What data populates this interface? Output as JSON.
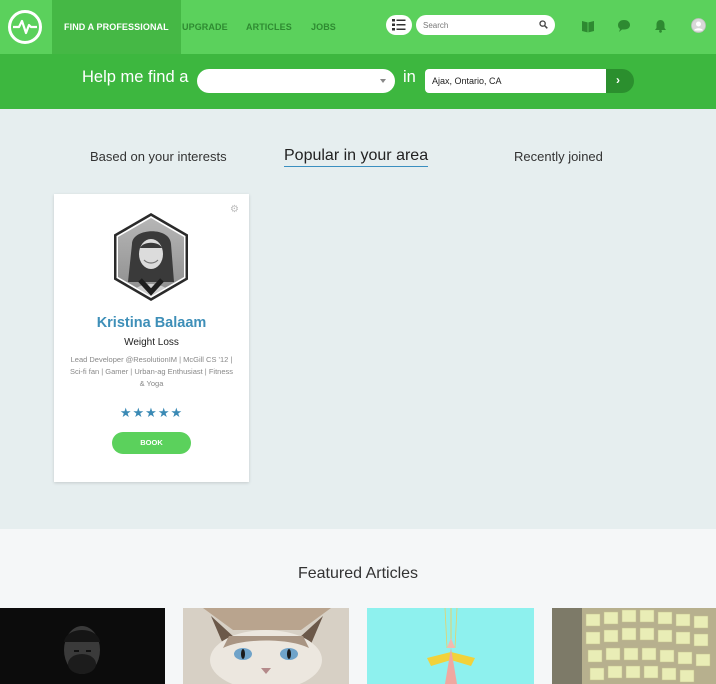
{
  "nav": {
    "items": [
      {
        "label": "FIND A PROFESSIONAL",
        "active": true
      },
      {
        "label": "UPGRADE"
      },
      {
        "label": "ARTICLES"
      },
      {
        "label": "JOBS"
      }
    ],
    "search_placeholder": "Search",
    "icons": [
      "list-view-icon",
      "search-icon",
      "book-icon",
      "chat-icon",
      "bell-icon",
      "avatar-icon"
    ]
  },
  "finder": {
    "help_text": "Help me find a",
    "role_value": "",
    "in_text": "in",
    "location_value": "Ajax, Ontario, CA",
    "go_icon": "›"
  },
  "tabs": [
    {
      "label": "Based on your interests"
    },
    {
      "label": "Popular in your area",
      "active": true
    },
    {
      "label": "Recently joined"
    }
  ],
  "card": {
    "name": "Kristina Balaam",
    "specialty": "Weight Loss",
    "bio": "Lead Developer @ResolutionIM | McGill CS '12 | Sci-fi fan | Gamer | Urban-ag Enthusiast | Fitness & Yoga",
    "stars": "★★★★★",
    "rating": 5,
    "book_label": "BOOK",
    "gear_icon": "⚙"
  },
  "featured": {
    "title": "Featured Articles"
  },
  "colors": {
    "nav_green": "#5bd15c",
    "finder_green": "#3db73f",
    "accent_blue": "#3e8fb8",
    "bg_grey": "#e6eeef"
  }
}
